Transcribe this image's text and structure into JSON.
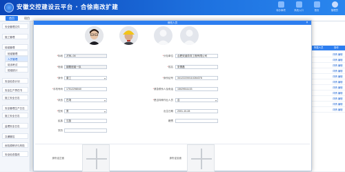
{
  "app": {
    "title": "安徽交控建设云平台 · 合徐南改扩建",
    "top_icons": [
      {
        "name": "notification",
        "label": "待办事项"
      },
      {
        "name": "portal",
        "label": "系统入口"
      },
      {
        "name": "home",
        "label": "首页"
      },
      {
        "name": "user",
        "label": "管理员"
      }
    ]
  },
  "tabs": [
    {
      "label": "首页",
      "active": true
    },
    {
      "label": "项目",
      "active": false
    }
  ],
  "sidebar": {
    "items": [
      {
        "label": "安全管理文件",
        "sub": false,
        "active": false
      },
      {
        "label": "施工管理",
        "sub": false,
        "active": false
      },
      {
        "label": "班组管理",
        "sub": false,
        "active": true
      },
      {
        "label": "班组管理",
        "sub": true,
        "active": false
      },
      {
        "label": "人员管理",
        "sub": true,
        "active": true
      },
      {
        "label": "培训考试",
        "sub": true,
        "active": false
      },
      {
        "label": "班组统计",
        "sub": true,
        "active": false
      },
      {
        "label": "安全检查计划",
        "sub": false,
        "active": false
      },
      {
        "label": "安全生产责任书",
        "sub": false,
        "active": false
      },
      {
        "label": "施工安全日志",
        "sub": false,
        "active": false
      },
      {
        "label": "安全管理生产日志",
        "sub": false,
        "active": false
      },
      {
        "label": "施工安全日志",
        "sub": false,
        "active": false
      },
      {
        "label": "监理安全日志",
        "sub": false,
        "active": false
      },
      {
        "label": "交通管控",
        "sub": false,
        "active": false
      },
      {
        "label": "危险源辨识与风险",
        "sub": false,
        "active": false
      },
      {
        "label": "安全检查整改",
        "sub": false,
        "active": false
      }
    ]
  },
  "right_panel": {
    "headers": [
      "所属人员",
      "操作"
    ],
    "row_action": "详情 编辑",
    "row_count": 11
  },
  "modal": {
    "title": "修改人员",
    "close_label": "×",
    "photos": [
      {
        "kind": "woman-with-glasses"
      },
      {
        "kind": "man-with-helmet"
      },
      {
        "kind": "empty"
      },
      {
        "kind": "empty"
      }
    ],
    "fields_left": [
      {
        "label": "标段",
        "required": true,
        "value": "JTBL-04",
        "readonly": true,
        "select": false
      },
      {
        "label": "班组",
        "required": true,
        "value": "钢筋班组一队",
        "readonly": true,
        "select": false
      },
      {
        "label": "身份",
        "required": true,
        "value": "普工",
        "readonly": false,
        "select": true
      },
      {
        "label": "手机号码",
        "required": true,
        "value": "17512298040",
        "readonly": false,
        "select": false
      },
      {
        "label": "状态",
        "required": true,
        "value": "在场",
        "readonly": false,
        "select": true
      },
      {
        "label": "性别",
        "required": true,
        "value": "男",
        "readonly": false,
        "select": true
      },
      {
        "label": "民族",
        "required": false,
        "value": "汉族",
        "readonly": false,
        "select": false
      },
      {
        "label": "学历",
        "required": false,
        "value": "",
        "readonly": false,
        "select": false
      }
    ],
    "fields_right": [
      {
        "label": "分包单位",
        "required": true,
        "value": "合肥双涵劳务工程有限公司",
        "readonly": false,
        "select": false
      },
      {
        "label": "姓名",
        "required": true,
        "value": "张蕾磊",
        "readonly": false,
        "select": false
      },
      {
        "label": "身份证号",
        "required": true,
        "value": "341222200110284378",
        "readonly": false,
        "select": false
      },
      {
        "label": "紧急联系人及电话",
        "required": true,
        "value": "15029511133",
        "readonly": false,
        "select": false
      },
      {
        "label": "是否特种作业人员",
        "required": true,
        "value": "否",
        "readonly": false,
        "select": true
      },
      {
        "label": "出生日期",
        "required": false,
        "value": "2001-10-28",
        "readonly": false,
        "select": false
      },
      {
        "label": "籍贯",
        "required": false,
        "value": "",
        "readonly": false,
        "select": false
      }
    ],
    "cert_front_label": "身份证正面",
    "cert_back_label": "身份证反面"
  }
}
